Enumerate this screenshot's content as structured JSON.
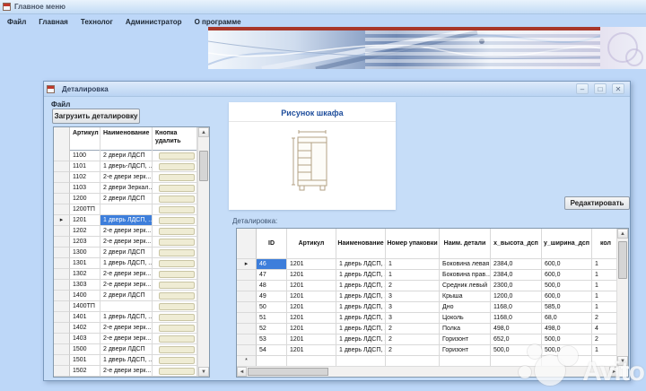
{
  "main_window": {
    "title": "Главное меню",
    "menu": [
      "Файл",
      "Главная",
      "Технолог",
      "Администратор",
      "О программе"
    ]
  },
  "child_window": {
    "title": "Деталировка",
    "menu_file": "Файл",
    "load_button_label": "Загрузить деталировку",
    "edit_button_label": "Редактировать",
    "picture_panel_title": "Рисунок шкафа",
    "detail_section_label": "Деталировка:",
    "controls": {
      "minimize": "–",
      "restore": "□",
      "close": "✕"
    }
  },
  "articles_grid": {
    "columns": [
      "Артикул",
      "Наименование",
      "Кнопка удалить"
    ],
    "selected_article": "1201",
    "rows": [
      {
        "article": "1100",
        "name": "2 двери ЛДСП",
        "selected": false
      },
      {
        "article": "1101",
        "name": "1 дверь-ЛДСП, ...",
        "selected": false
      },
      {
        "article": "1102",
        "name": "2-е двери зерк...",
        "selected": false
      },
      {
        "article": "1103",
        "name": "2 двери Зеркал...",
        "selected": false
      },
      {
        "article": "1200",
        "name": "2 двери ЛДСП",
        "selected": false
      },
      {
        "article": "1200ТП",
        "name": "",
        "selected": false
      },
      {
        "article": "1201",
        "name": "1 дверь ЛДСП, ...",
        "selected": true
      },
      {
        "article": "1202",
        "name": "2-е двери зерк...",
        "selected": false
      },
      {
        "article": "1203",
        "name": "2-е двери зерк...",
        "selected": false
      },
      {
        "article": "1300",
        "name": "2 двери ЛДСП",
        "selected": false
      },
      {
        "article": "1301",
        "name": "1 дверь ЛДСП, ...",
        "selected": false
      },
      {
        "article": "1302",
        "name": "2-е двери зерк...",
        "selected": false
      },
      {
        "article": "1303",
        "name": "2-е двери зерк...",
        "selected": false
      },
      {
        "article": "1400",
        "name": "2 двери ЛДСП",
        "selected": false
      },
      {
        "article": "1400ТП",
        "name": "",
        "selected": false
      },
      {
        "article": "1401",
        "name": "1 дверь ЛДСП, ...",
        "selected": false
      },
      {
        "article": "1402",
        "name": "2-е двери зерк...",
        "selected": false
      },
      {
        "article": "1403",
        "name": "2-е двери зерк...",
        "selected": false
      },
      {
        "article": "1500",
        "name": "2 двери ЛДСП",
        "selected": false
      },
      {
        "article": "1501",
        "name": "1 дверь ЛДСП, ...",
        "selected": false
      },
      {
        "article": "1502",
        "name": "2-е двери зерк...",
        "selected": false
      }
    ]
  },
  "detail_grid": {
    "columns": [
      "ID",
      "Артикул",
      "Наименование",
      "Номер упаковки",
      "Наим. детали",
      "x_высота_дсп",
      "у_ширина_дсп",
      "кол"
    ],
    "new_row_marker": "*",
    "selected_cell": {
      "row": 0,
      "column": "ID"
    },
    "rows": [
      [
        "46",
        "1201",
        "1 дверь ЛДСП, ...",
        "1",
        "Боковина левая",
        "2384,0",
        "600,0",
        "1"
      ],
      [
        "47",
        "1201",
        "1 дверь ЛДСП, ...",
        "1",
        "Боковина прав...",
        "2384,0",
        "600,0",
        "1"
      ],
      [
        "48",
        "1201",
        "1 дверь ЛДСП, ...",
        "2",
        "Средник левый",
        "2300,0",
        "500,0",
        "1"
      ],
      [
        "49",
        "1201",
        "1 дверь ЛДСП, ...",
        "3",
        "Крыша",
        "1200,0",
        "600,0",
        "1"
      ],
      [
        "50",
        "1201",
        "1 дверь ЛДСП, ...",
        "3",
        "Дно",
        "1168,0",
        "585,0",
        "1"
      ],
      [
        "51",
        "1201",
        "1 дверь ЛДСП, ...",
        "3",
        "Цоколь",
        "1168,0",
        "68,0",
        "2"
      ],
      [
        "52",
        "1201",
        "1 дверь ЛДСП, ...",
        "2",
        "Полка",
        "498,0",
        "498,0",
        "4"
      ],
      [
        "53",
        "1201",
        "1 дверь ЛДСП, ...",
        "2",
        "Горизонт",
        "652,0",
        "500,0",
        "2"
      ],
      [
        "54",
        "1201",
        "1 дверь ЛДСП, ...",
        "2",
        "Горизонт",
        "500,0",
        "500,0",
        "1"
      ]
    ]
  },
  "colors": {
    "selection_blue": "#3d7edb",
    "banner_red": "#a8372a",
    "picture_title_blue": "#1f4e9c",
    "desktop_blue": "#bdd7f8"
  },
  "watermark": {
    "text": "Avito"
  }
}
